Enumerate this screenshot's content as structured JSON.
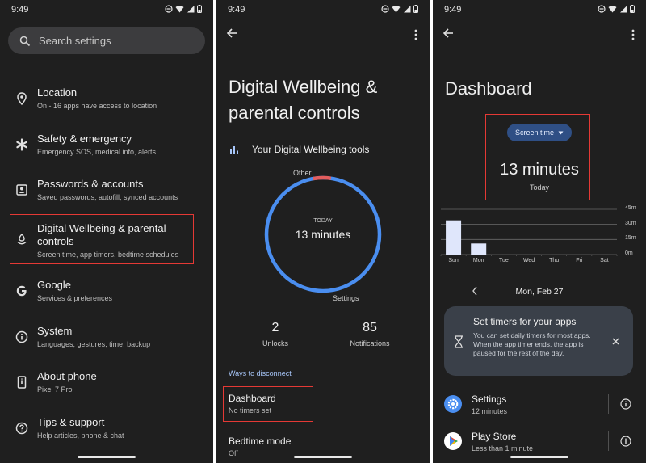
{
  "status_time": "9:49",
  "panel1": {
    "search_placeholder": "Search settings",
    "items": [
      {
        "title": "Location",
        "sub": "On - 16 apps have access to location",
        "icon": "location-pin-icon"
      },
      {
        "title": "Safety & emergency",
        "sub": "Emergency SOS, medical info, alerts",
        "icon": "asterisk-icon"
      },
      {
        "title": "Passwords & accounts",
        "sub": "Saved passwords, autofill, synced accounts",
        "icon": "account-box-icon"
      },
      {
        "title": "Digital Wellbeing & parental controls",
        "sub": "Screen time, app timers, bedtime schedules",
        "icon": "wellbeing-icon"
      },
      {
        "title": "Google",
        "sub": "Services & preferences",
        "icon": "google-g-icon"
      },
      {
        "title": "System",
        "sub": "Languages, gestures, time, backup",
        "icon": "info-icon"
      },
      {
        "title": "About phone",
        "sub": "Pixel 7 Pro",
        "icon": "phone-icon"
      },
      {
        "title": "Tips & support",
        "sub": "Help articles, phone & chat",
        "icon": "help-icon"
      }
    ]
  },
  "panel2": {
    "title_line1": "Digital Wellbeing &",
    "title_line2": "parental controls",
    "tools_label": "Your Digital Wellbeing tools",
    "ring": {
      "center_label": "TODAY",
      "center_value": "13 minutes",
      "label_other": "Other",
      "label_settings": "Settings",
      "other_fraction": 0.05
    },
    "unlocks_value": "2",
    "unlocks_label": "Unlocks",
    "notifications_value": "85",
    "notifications_label": "Notifications",
    "ways_label": "Ways to disconnect",
    "dashboard_title": "Dashboard",
    "dashboard_sub": "No timers set",
    "bedtime_title": "Bedtime mode",
    "bedtime_sub": "Off"
  },
  "panel3": {
    "title": "Dashboard",
    "selector_label": "Screen time",
    "total": "13 minutes",
    "total_label": "Today",
    "date_label": "Mon, Feb 27",
    "card_title": "Set timers for your apps",
    "card_body": "You can set daily timers for most apps. When the app timer ends, the app is paused for the rest of the day.",
    "apps": [
      {
        "name": "Settings",
        "sub": "12 minutes"
      },
      {
        "name": "Play Store",
        "sub": "Less than 1 minute"
      }
    ]
  },
  "chart_data": {
    "type": "bar",
    "categories": [
      "Sun",
      "Mon",
      "Tue",
      "Wed",
      "Thu",
      "Fri",
      "Sat"
    ],
    "values": [
      34,
      11,
      0,
      0,
      0,
      0,
      0
    ],
    "y_ticks": [
      "0m",
      "15m",
      "30m",
      "45m"
    ],
    "ylim": [
      0,
      45
    ],
    "grid": true
  },
  "colors": {
    "background": "#1f1f1f",
    "accent_blue": "#4a8ef0",
    "ring_other": "#e35d5d",
    "highlight_red": "#e53935",
    "bar_fill": "#dfe6fb"
  }
}
